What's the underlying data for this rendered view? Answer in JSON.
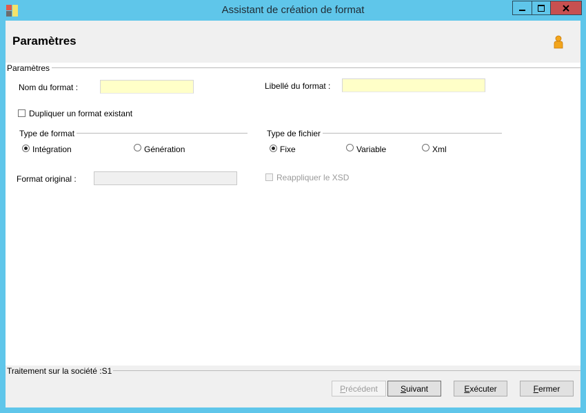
{
  "window": {
    "title": "Assistant de création de format"
  },
  "header": {
    "title": "Paramètres"
  },
  "params_group": {
    "label": "Paramètres"
  },
  "fields": {
    "nom_label": "Nom du format :",
    "nom_value": "",
    "libelle_label": "Libellé du format :",
    "libelle_value": "",
    "dupliquer_label": "Dupliquer un format existant",
    "format_original_label": "Format original :",
    "format_original_value": "",
    "reappliquer_label": "Reappliquer le XSD"
  },
  "type_format": {
    "label": "Type de format",
    "options": [
      "Intégration",
      "Génération"
    ],
    "selected": "Intégration"
  },
  "type_fichier": {
    "label": "Type de fichier",
    "options": [
      "Fixe",
      "Variable",
      "Xml"
    ],
    "selected": "Fixe"
  },
  "footer": {
    "status": "Traitement sur la société :S1",
    "buttons": {
      "precedent": {
        "first": "P",
        "rest": "récédent"
      },
      "suivant": {
        "first": "S",
        "rest": "uivant"
      },
      "executer": {
        "first": "E",
        "rest": "xécuter"
      },
      "fermer": {
        "first": "F",
        "rest": "ermer"
      }
    }
  },
  "colors": {
    "titlebar": "#5fc6ea",
    "input_yellow": "#ffffc8",
    "close": "#c75050"
  },
  "icons": [
    "app-icon",
    "minimize-icon",
    "maximize-icon",
    "close-icon",
    "person-icon"
  ]
}
